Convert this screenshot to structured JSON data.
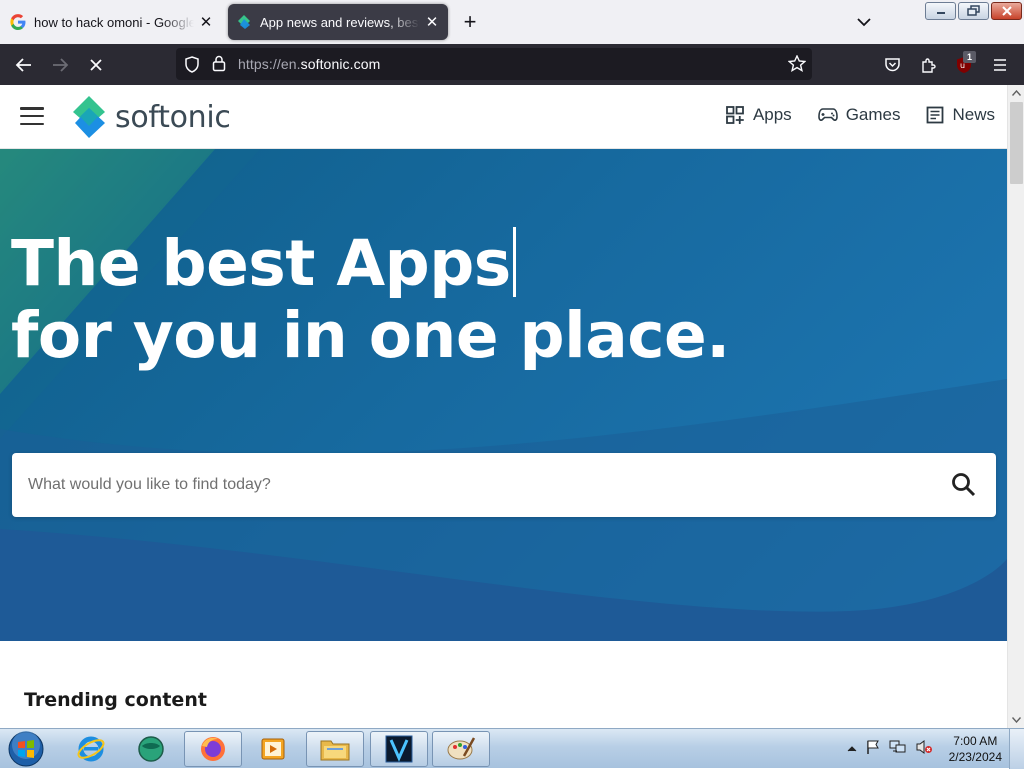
{
  "browser": {
    "tabs": [
      {
        "title": "how to hack omoni - Google Search",
        "active": false,
        "favicon": "google-icon"
      },
      {
        "title": "App news and reviews, best software downloads",
        "active": true,
        "favicon": "softonic-icon"
      }
    ],
    "url_host_prefix": "https://en.",
    "url_domain": "softonic.com",
    "extension_badge": "1"
  },
  "site": {
    "brand": "softonic",
    "nav": [
      {
        "label": "Apps",
        "icon": "apps-grid-icon"
      },
      {
        "label": "Games",
        "icon": "gamepad-icon"
      },
      {
        "label": "News",
        "icon": "news-icon"
      }
    ],
    "hero": {
      "line1": "The best Apps",
      "line2": "for you in one place."
    },
    "search": {
      "placeholder": "What would you like to find today?"
    },
    "trending_heading": "Trending content"
  },
  "taskbar": {
    "apps": [
      "internet-explorer-icon",
      "globe-app-icon",
      "firefox-icon",
      "media-player-icon",
      "file-explorer-icon",
      "v-app-icon",
      "paint-icon"
    ],
    "time": "7:00 AM",
    "date": "2/23/2024"
  },
  "colors": {
    "hero_blue": "#176aa0",
    "toolbar": "#2b2a33",
    "active_tab": "#3b3b46",
    "tabstrip": "#f0f0f4"
  }
}
